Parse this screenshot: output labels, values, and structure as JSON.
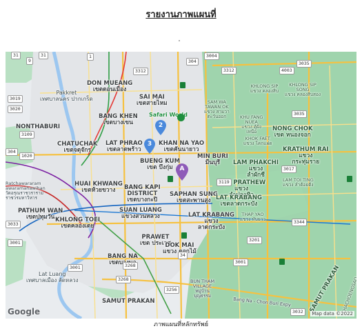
{
  "report": {
    "title": "รายงานภาพแผนที่",
    "caption": "ภาพแผนที่หลักทรัพย์"
  },
  "map": {
    "attribution": "Google",
    "map_data": "Map data ©2022",
    "markers": [
      {
        "label": "2",
        "color": "#4a89dc"
      },
      {
        "label": "3",
        "color": "#4a89dc"
      },
      {
        "label": "A",
        "color": "#8e5bb8"
      }
    ],
    "places": {
      "don_mueang": "DON MUEANG",
      "don_mueang_th": "เขตดอนเมือง",
      "sai_mai": "SAI MAI",
      "sai_mai_th": "เขตสายไหม",
      "safari_world": "Safari World",
      "bang_khen": "BANG KHEN",
      "bang_khen_th": "เขตบางเขน",
      "lat_phrao": "LAT PHRAO",
      "lat_phrao_th": "เขตลาดพร้าว",
      "khan_na_yao": "KHAN NA YAO",
      "khan_na_yao_th": "เขตคันนายาว",
      "bueng_kum": "BUENG KUM",
      "bueng_kum_th": "เขต บึงกุ่ม",
      "min_buri": "MIN BURI",
      "min_buri_th": "มีนบุรี",
      "nonthaburi": "NONTHABURI",
      "pakkret": "Pakkret",
      "pakkret_th": "เทศบาลนคร ปากเกร็ด",
      "chatuchak": "CHATUCHAK",
      "chatuchak_th": "เขตจตุจักร",
      "huai_khwang": "HUAI KHWANG",
      "huai_khwang_th": "เขตห้วยขวาง",
      "bang_kapi": "BANG KAPI",
      "bang_kapi_district": "DISTRICT",
      "bang_kapi_th": "เขตบางกะปิ",
      "saphan_sung": "SAPHAN SUNG",
      "saphan_sung_th": "เขตสะพานสูง",
      "lam_phakchi": "LAM PHAKCHI",
      "lam_phakchi_th": "แขวง",
      "lam_phakchi_th2": "ลำผักชี",
      "lam_prathew": "LAM PRATHEW",
      "lam_prathew_th": "แขวง",
      "lam_prathew_th2": "ลำปลาทิว",
      "lat_krabang_dist": "LAT KRABANG",
      "lat_krabang_dist_th": "เขตลาดกระบัง",
      "krathum_rai": "KRATHUM RAI",
      "krathum_rai_th": "แขวง",
      "krathum_rai_th2": "กระทุ่มราย",
      "nong_chok": "NONG CHOK",
      "nong_chok_th": "เขต หนองจอก",
      "pathum_wan": "PATHUM WAN",
      "pathum_wan_th": "เขตปทุมวัน",
      "suan_luang": "SUAN LUANG",
      "suan_luang_th": "แขวงสวนหลวง",
      "lat_krabang": "LAT KRABANG",
      "lat_krabang_th": "แขวง",
      "lat_krabang_th2": "ลาดกระบัง",
      "khlong_toei": "KHLONG TOEI",
      "khlong_toei_th": "เขตคลองเตย",
      "prawet": "PRAWET",
      "prawet_th": "เขต ประเวศ",
      "dok_mai": "DOK MAI",
      "dok_mai_th": "แขวง ดอกไม้",
      "bang_na": "BANG NA",
      "bang_na_th": "เขตบางนา",
      "lat_luang": "Lat Luang",
      "lat_luang_th": "เทศบาลเมือง ลัดหลวง",
      "samut_prakan": "SAMUT PRAKAN",
      "samut_prakan_r": "SAMUT PRAKAN",
      "bun_tham": "BUN THAM",
      "bun_tham2": "VILLAGE",
      "bun_tham_th": "หมู่บ้าน",
      "bun_tham_th2": "บุญธรรม",
      "ratchawararam": "Ratchawararam",
      "ratchawararam2": "awaramahawihan",
      "ratchawararam_th": "วัดอรุณราชวราราม",
      "ratchawararam_th2": "ราชวรมหาวิหาร",
      "khlong_sip": "KHLONG SIP",
      "khlong_sip_th": "แขวง คลองสิบ",
      "khlong_sip_song": "KHLONG SIP",
      "khlong_sip_song2": "SONG",
      "khlong_sip_song_th": "แขวง คลองสิบสอง",
      "sam_wa": "SAM WA",
      "sam_wa2": "TAWAN OK",
      "sam_wa_th": "แขวง สามวา",
      "sam_wa_th2": "ตะวันออก",
      "khu_fang": "KHU FANG",
      "khu_fang2": "NUEA",
      "khu_fang_th": "แขวง คู้ฝั่ง",
      "khu_fang_th2": "เหนือ",
      "khok_faet": "KHOK FAET",
      "khok_faet_th": "แขวง โคกแฝด",
      "lam_toi_ting": "LAM TOI TING",
      "lam_toi_ting_th": "แขวง ลำต้อยติ่ง",
      "thap_yao": "THAP YAO",
      "thap_yao_th": "แขวง ทับยาว",
      "chachoengsao": "CHACHOENGSAO",
      "bang_na_chon_buri": "Bang Na - Chon Buri Expy"
    },
    "routes": {
      "r1": "1",
      "r9": "9",
      "r31": "31",
      "r304": "304",
      "r3004": "3004",
      "r3312": "3312",
      "r3312b": "3312",
      "r4003": "4003",
      "r3035": "3035",
      "r3035b": "3035",
      "r3119": "3119",
      "r3344": "3344",
      "r3001": "3001",
      "r34": "34",
      "r304b": "304",
      "r3268": "3268",
      "r3256": "3256",
      "r3019": "3019",
      "r3020": "3020",
      "r1020": "1020",
      "r3033": "3033",
      "r3001b": "3001",
      "r3001c": "3001",
      "r3268b": "3268",
      "r3017": "3017",
      "r3201": "3201",
      "r3109": "3109",
      "r31b": "31",
      "r3032": "3032"
    }
  }
}
